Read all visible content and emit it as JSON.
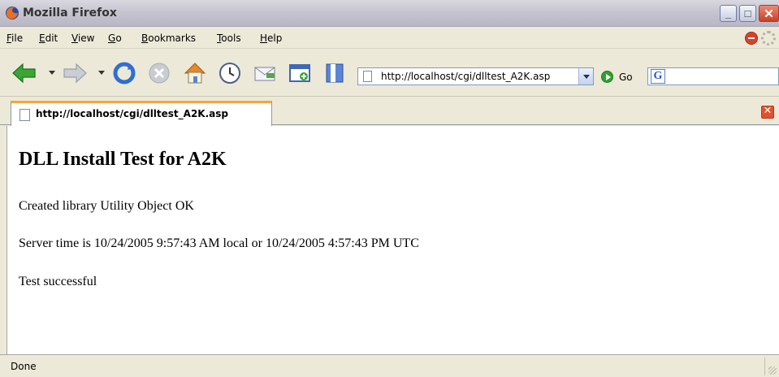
{
  "window": {
    "title": "Mozilla Firefox",
    "controls": {
      "minimize": "_",
      "maximize": "□",
      "close": "✕"
    }
  },
  "menu": {
    "items": [
      {
        "label": "File",
        "accel": "F",
        "rest": "ile"
      },
      {
        "label": "Edit",
        "accel": "E",
        "rest": "dit"
      },
      {
        "label": "View",
        "accel": "V",
        "rest": "iew"
      },
      {
        "label": "Go",
        "accel": "G",
        "rest": "o"
      },
      {
        "label": "Bookmarks",
        "accel": "B",
        "rest": "ookmarks"
      },
      {
        "label": "Tools",
        "accel": "T",
        "rest": "ools"
      },
      {
        "label": "Help",
        "accel": "H",
        "rest": "elp"
      }
    ]
  },
  "toolbar": {
    "buttons": [
      "back",
      "forward",
      "reload",
      "stop",
      "home",
      "history",
      "mail",
      "new-tab",
      "bookmarks"
    ],
    "url": "http://localhost/cgi/dlltest_A2K.asp",
    "go_label": "Go",
    "search_engine_letter": "G",
    "search_value": ""
  },
  "tabs": [
    {
      "label": "http://localhost/cgi/dlltest_A2K.asp",
      "active": true
    }
  ],
  "page": {
    "heading": "DLL Install Test for A2K",
    "line1": "Created library Utility Object OK",
    "line2": "Server time is 10/24/2005 9:57:43 AM local or 10/24/2005 4:57:43 PM UTC",
    "line3": "Test successful"
  },
  "status": {
    "text": "Done"
  },
  "colors": {
    "tab_accent": "#f5a63c",
    "close_red": "#c84124",
    "link_blue": "#2a55c9"
  }
}
